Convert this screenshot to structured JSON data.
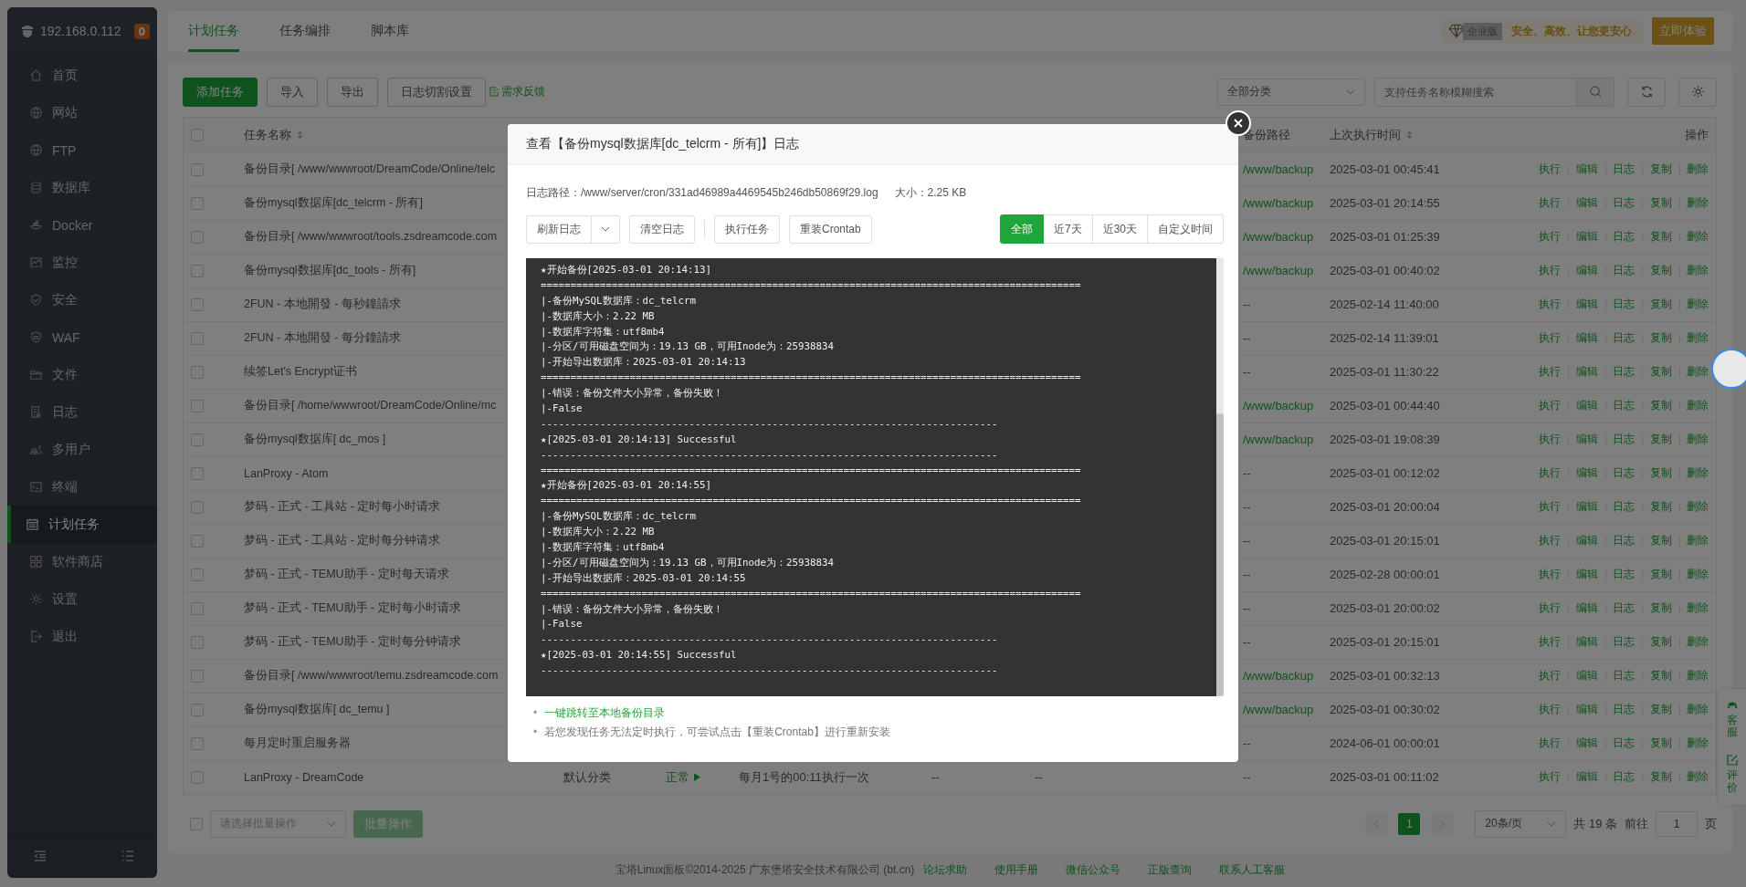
{
  "sidebar": {
    "host": "192.168.0.112",
    "badge": "0",
    "items": [
      {
        "label": "首页",
        "selected": false
      },
      {
        "label": "网站",
        "selected": false
      },
      {
        "label": "FTP",
        "selected": false
      },
      {
        "label": "数据库",
        "selected": false
      },
      {
        "label": "Docker",
        "selected": false
      },
      {
        "label": "监控",
        "selected": false
      },
      {
        "label": "安全",
        "selected": false
      },
      {
        "label": "WAF",
        "selected": false
      },
      {
        "label": "文件",
        "selected": false
      },
      {
        "label": "日志",
        "selected": false
      },
      {
        "label": "多用户",
        "selected": false
      },
      {
        "label": "终端",
        "selected": false
      },
      {
        "label": "计划任务",
        "selected": true
      },
      {
        "label": "软件商店",
        "selected": false
      },
      {
        "label": "设置",
        "selected": false
      },
      {
        "label": "退出",
        "selected": false
      }
    ]
  },
  "tabs": [
    {
      "label": "计划任务",
      "selected": true
    },
    {
      "label": "任务编排",
      "selected": false
    },
    {
      "label": "脚本库",
      "selected": false
    }
  ],
  "promo": {
    "edition": "企业版",
    "slogan": "安全、高效、让您更安心",
    "button": "立即体验"
  },
  "toolbar": {
    "buttons": [
      {
        "label": "添加任务",
        "kind": "primary"
      },
      {
        "label": "导入",
        "kind": "default"
      },
      {
        "label": "导出",
        "kind": "default"
      },
      {
        "label": "日志切割设置",
        "kind": "default"
      }
    ],
    "feedback": "需求反馈",
    "category": "全部分类",
    "search": {
      "placeholder": "支持任务名称模糊搜索"
    }
  },
  "table": {
    "all_checked": false,
    "columns": {
      "name": "任务名称",
      "backup_path": "备份路径",
      "last_run": "上次执行时间",
      "actions": "操作"
    },
    "rows": [
      {
        "checked": false,
        "name": "备份目录[ /www/wwwroot/DreamCode/Online/telc",
        "backup_path": "/www/backup",
        "last_run": "2025-03-01 00:45:41",
        "actions": [
          "执行",
          "编辑",
          "日志",
          "复制",
          "删除"
        ]
      },
      {
        "checked": false,
        "name": "备份mysql数据库[dc_telcrm - 所有]",
        "backup_path": "/www/backup",
        "last_run": "2025-03-01 20:14:55",
        "actions": [
          "执行",
          "编辑",
          "日志",
          "复制",
          "删除"
        ]
      },
      {
        "checked": false,
        "name": "备份目录[ /www/wwwroot/tools.zsdreamcode.com",
        "backup_path": "/www/backup",
        "last_run": "2025-03-01 01:25:39",
        "actions": [
          "执行",
          "编辑",
          "日志",
          "复制",
          "删除"
        ]
      },
      {
        "checked": false,
        "name": "备份mysql数据库[dc_tools - 所有]",
        "backup_path": "/www/backup",
        "last_run": "2025-03-01 00:40:02",
        "actions": [
          "执行",
          "编辑",
          "日志",
          "复制",
          "删除"
        ]
      },
      {
        "checked": false,
        "name": "2FUN - 本地開發 - 每秒鐘請求",
        "backup_path": "--",
        "last_run": "2025-02-14 11:40:00",
        "actions": [
          "执行",
          "编辑",
          "日志",
          "复制",
          "删除"
        ]
      },
      {
        "checked": false,
        "name": "2FUN - 本地開發 - 每分鐘請求",
        "backup_path": "--",
        "last_run": "2025-02-14 11:39:01",
        "actions": [
          "执行",
          "编辑",
          "日志",
          "复制",
          "删除"
        ]
      },
      {
        "checked": false,
        "name": "续签Let's Encrypt证书",
        "backup_path": "--",
        "last_run": "2025-03-01 11:30:22",
        "actions": [
          "执行",
          "编辑",
          "日志",
          "复制",
          "删除"
        ]
      },
      {
        "checked": false,
        "name": "备份目录[ /home/wwwroot/DreamCode/Online/mc",
        "backup_path": "/www/backup",
        "last_run": "2025-03-01 00:44:40",
        "actions": [
          "执行",
          "编辑",
          "日志",
          "复制",
          "删除"
        ]
      },
      {
        "checked": false,
        "name": "备份mysql数据库[ dc_mos ]",
        "backup_path": "/www/backup",
        "last_run": "2025-03-01 19:08:39",
        "actions": [
          "执行",
          "编辑",
          "日志",
          "复制",
          "删除"
        ]
      },
      {
        "checked": false,
        "name": "LanProxy - Atom",
        "backup_path": "--",
        "last_run": "2025-03-01 00:12:02",
        "actions": [
          "执行",
          "编辑",
          "日志",
          "复制",
          "删除"
        ]
      },
      {
        "checked": false,
        "name": "梦码 - 正式 - 工具站 - 定时每小时请求",
        "backup_path": "--",
        "last_run": "2025-03-01 20:00:04",
        "actions": [
          "执行",
          "编辑",
          "日志",
          "复制",
          "删除"
        ]
      },
      {
        "checked": false,
        "name": "梦码 - 正式 - 工具站 - 定时每分钟请求",
        "backup_path": "--",
        "last_run": "2025-03-01 20:15:01",
        "actions": [
          "执行",
          "编辑",
          "日志",
          "复制",
          "删除"
        ]
      },
      {
        "checked": false,
        "name": "梦码 - 正式 - TEMU助手 - 定时每天请求",
        "backup_path": "--",
        "last_run": "2025-02-28 00:00:01",
        "actions": [
          "执行",
          "编辑",
          "日志",
          "复制",
          "删除"
        ]
      },
      {
        "checked": false,
        "name": "梦码 - 正式 - TEMU助手 - 定时每小时请求",
        "backup_path": "--",
        "last_run": "2025-03-01 20:00:02",
        "actions": [
          "执行",
          "编辑",
          "日志",
          "复制",
          "删除"
        ]
      },
      {
        "checked": false,
        "name": "梦码 - 正式 - TEMU助手 - 定时每分钟请求",
        "backup_path": "--",
        "last_run": "2025-03-01 20:15:01",
        "actions": [
          "执行",
          "编辑",
          "日志",
          "复制",
          "删除"
        ]
      },
      {
        "checked": false,
        "name": "备份目录[ /www/wwwroot/temu.zsdreamcode.com",
        "backup_path": "/www/backup",
        "last_run": "2025-03-01 00:32:13",
        "actions": [
          "执行",
          "编辑",
          "日志",
          "复制",
          "删除"
        ]
      },
      {
        "checked": false,
        "name": "备份mysql数据库[ dc_temu ]",
        "backup_path": "/www/backup",
        "last_run": "2025-03-01 00:30:02",
        "actions": [
          "执行",
          "编辑",
          "日志",
          "复制",
          "删除"
        ]
      },
      {
        "checked": false,
        "name": "每月定时重启服务器",
        "backup_path": "--",
        "last_run": "2024-06-01 00:00:01",
        "actions": [
          "执行",
          "编辑",
          "日志",
          "复制",
          "删除"
        ]
      },
      {
        "checked": false,
        "name": "LanProxy - DreamCode",
        "category": "默认分类",
        "status": "正常",
        "cycle": "每月1号的00:11执行一次",
        "column_5": "--",
        "column_6": "--",
        "backup_path": "--",
        "last_run": "2025-03-01 00:11:02",
        "actions": [
          "执行",
          "编辑",
          "日志",
          "复制",
          "删除"
        ]
      }
    ]
  },
  "batch": {
    "checked": false,
    "placeholder": "请选择批量操作",
    "button": "批量操作",
    "disabled": true
  },
  "pager": {
    "pages": [
      {
        "label": "1",
        "selected": true
      }
    ],
    "page_size": "20条/页",
    "total": "共 19 条",
    "goto": "前往",
    "goto_value": "1",
    "page_unit": "页"
  },
  "footer": {
    "copyright": "宝塔Linux面板©2014-2025 广东堡塔安全技术有限公司 (bt.cn)",
    "links": [
      "论坛求助",
      "使用手册",
      "微信公众号",
      "正版查询",
      "联系人工客服"
    ]
  },
  "side_widget": [
    "客服",
    "评价"
  ],
  "modal": {
    "title": "查看【备份mysql数据库[dc_telcrm - 所有]】日志",
    "path_label": "日志路径：",
    "path": "/www/server/cron/331ad46989a4469545b246db50869f29.log",
    "size_label": "大小：",
    "size": "2.25 KB",
    "buttons": [
      "刷新日志",
      "清空日志",
      "执行任务",
      "重装Crontab"
    ],
    "ranges": [
      {
        "label": "全部",
        "selected": true
      },
      {
        "label": "近7天",
        "selected": false
      },
      {
        "label": "近30天",
        "selected": false
      },
      {
        "label": "自定义时间",
        "selected": false
      }
    ],
    "log": [
      "★开始备份[2025-03-01 20:14:13]",
      "===========================================================================================",
      "|-备份MySQL数据库：dc_telcrm",
      "|-数据库大小：2.22 MB",
      "|-数据库字符集：utf8mb4",
      "|-分区/可用磁盘空间为：19.13 GB，可用Inode为：25938834",
      "|-开始导出数据库：2025-03-01 20:14:13",
      "===========================================================================================",
      "|-错误：备份文件大小异常，备份失败！",
      "|-False",
      "-----------------------------------------------------------------------------",
      "★[2025-03-01 20:14:13] Successful",
      "-----------------------------------------------------------------------------",
      "===========================================================================================",
      "★开始备份[2025-03-01 20:14:55]",
      "===========================================================================================",
      "|-备份MySQL数据库：dc_telcrm",
      "|-数据库大小：2.22 MB",
      "|-数据库字符集：utf8mb4",
      "|-分区/可用磁盘空间为：19.13 GB，可用Inode为：25938834",
      "|-开始导出数据库：2025-03-01 20:14:55",
      "===========================================================================================",
      "|-错误：备份文件大小异常，备份失败！",
      "|-False",
      "-----------------------------------------------------------------------------",
      "★[2025-03-01 20:14:55] Successful",
      "-----------------------------------------------------------------------------"
    ],
    "notes": [
      {
        "marker": "•",
        "text": "一键跳转至本地备份目录",
        "kind": "link"
      },
      {
        "marker": "•",
        "text": "若您发现任务无法定时执行，可尝试点击【重装Crontab】进行重新安装",
        "kind": "text"
      }
    ]
  }
}
